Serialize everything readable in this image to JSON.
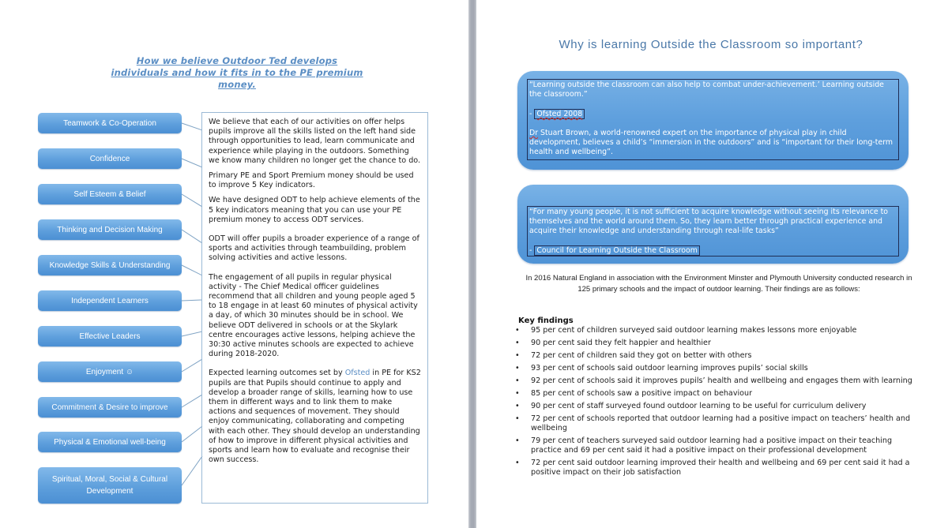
{
  "left_page": {
    "title": "How we believe Outdoor Ted develops individuals and how it fits in to the PE premium money.",
    "skills": [
      "Teamwork & Co-Operation",
      "Confidence",
      "Self Esteem & Belief",
      "Thinking and Decision Making",
      "Knowledge Skills & Understanding",
      "Independent Learners",
      "Effective Leaders",
      "Enjoyment ☺",
      "Commitment & Desire to improve",
      "Physical & Emotional well-being",
      "Spiritual, Moral, Social & Cultural Development"
    ],
    "paragraphs": {
      "p1": "We believe that each of our activities on offer helps pupils improve all the skills listed on the left hand side through opportunities to lead, learn communicate and experience while playing in the outdoors. Something we know many children no longer get the chance to do.",
      "p2": "Primary PE and Sport Premium money should be used to improve 5 Key indicators.",
      "p3": "We have designed ODT to help achieve elements of the 5 key indicators meaning that you can use your PE premium money to access ODT services.",
      "p4": "ODT will offer pupils a broader experience of a range of sports and activities through teambuilding, problem solving activities and active lessons.",
      "p5": "The engagement of all pupils in regular physical activity - The Chief Medical officer guidelines recommend that all children and young people aged 5 to 18 engage in at least 60 minutes of physical activity a day, of which 30 minutes should be in school. We believe ODT delivered in schools or at the Skylark centre encourages active lessons, helping achieve the 30:30 active minutes schools are expected to achieve during 2018-2020.",
      "p6_before": "Expected learning outcomes set by ",
      "p6_link": "Ofsted",
      "p6_after": " in PE for KS2 pupils are that Pupils should continue to apply and develop a broader range of skills, learning how to use them in different ways and to link them to make actions and sequences of movement. They should enjoy communicating, collaborating and competing with each other. They should develop an understanding of how to improve in different physical activities and sports and learn how to evaluate and recognise their own success."
    }
  },
  "right_page": {
    "title": "Why is learning Outside the Classroom so important?",
    "quote1": {
      "text": "“Learning outside the classroom can also help to combat under-achievement.’ Learning outside the classroom.”",
      "source_prefix": "- ",
      "source": "Ofsted 2008",
      "extra_prefix": "Dr",
      "extra": " Stuart Brown, a world-renowned expert on the importance of physical play in child development, believes a child’s “immersion in the outdoors” and is “important for their long-term health and wellbeing”."
    },
    "quote2": {
      "text": "“For many young people, it is not sufficient to acquire knowledge without seeing its relevance to themselves and the world around them. So, they learn better through practical experience and acquire their knowledge and understanding through real-life tasks”",
      "source_prefix": "- ",
      "source": "Council for Learning Outside the Classroom"
    },
    "research_intro": "In 2016 Natural England in association with the Environment Minster and Plymouth University conducted research in 125 primary schools and the impact of outdoor learning. Their findings are as follows:",
    "key_findings_heading": "Key findings",
    "bullet_glyph": "•",
    "key_findings": [
      "95 per cent of children surveyed said outdoor learning makes lessons more enjoyable",
      "90 per cent said they felt happier and healthier",
      "72 per cent of children said they got on better with others",
      "93 per cent of schools said outdoor learning improves pupils’ social skills",
      "92 per cent of schools said it improves pupils’ health and wellbeing and engages them with learning",
      "85 per cent of schools saw a positive impact on behaviour",
      "90 per cent of staff surveyed found outdoor learning to be useful for curriculum delivery",
      "72 per cent of schools reported that outdoor learning had a positive impact on teachers’ health and wellbeing",
      "79 per cent of teachers surveyed said outdoor learning had a positive impact on their teaching practice and 69 per cent said it had a positive impact on their professional development",
      "72 per cent said outdoor learning improved their health and wellbeing and 69 per cent said it had a positive impact on their job satisfaction"
    ]
  }
}
